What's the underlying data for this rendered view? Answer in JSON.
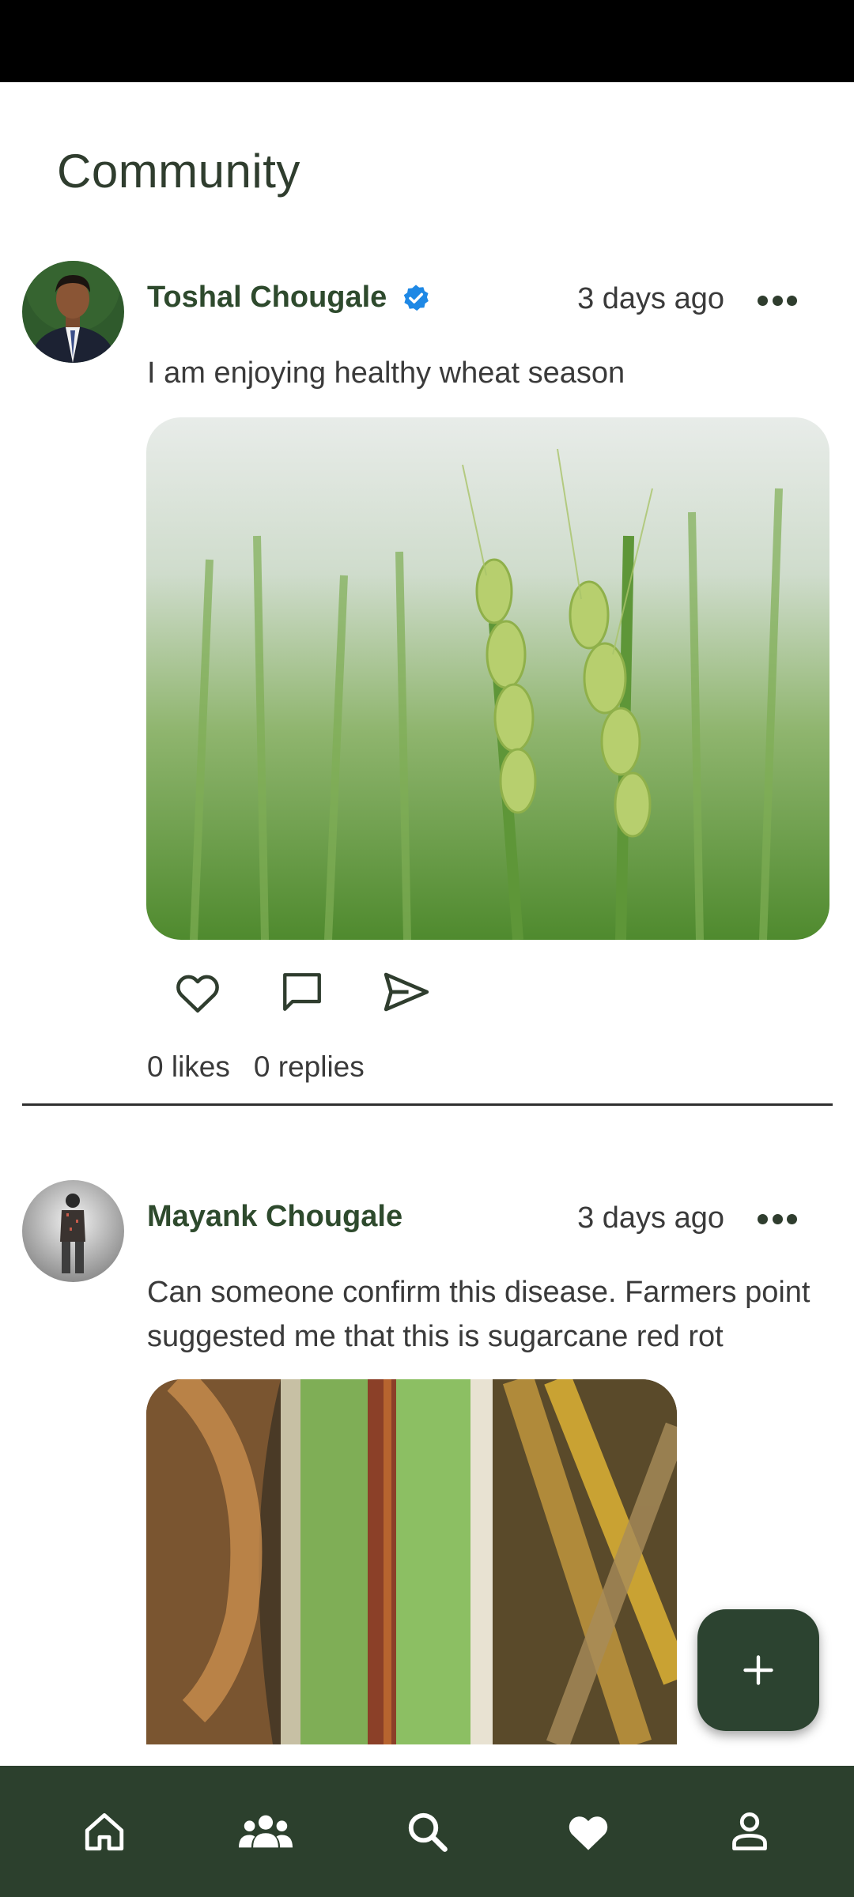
{
  "page": {
    "title": "Community"
  },
  "colors": {
    "primary": "#2c402d",
    "accent_verified": "#1e88e5",
    "text": "#3a3a3a"
  },
  "posts": [
    {
      "author": "Toshal Chougale",
      "verified": true,
      "time": "3 days ago",
      "text": "I am enjoying healthy wheat season",
      "image": "wheat-field-photo",
      "likes_label": "0 likes",
      "replies_label": "0 replies"
    },
    {
      "author": "Mayank Chougale",
      "verified": false,
      "time": "3 days ago",
      "text": "Can someone confirm this disease. Farmers point suggested me that this is sugarcane red rot",
      "image": "sugarcane-leaf-photo"
    }
  ],
  "fab": {
    "icon": "plus-icon"
  },
  "bottom_nav": [
    {
      "icon": "home-icon"
    },
    {
      "icon": "community-icon"
    },
    {
      "icon": "search-icon"
    },
    {
      "icon": "heart-icon"
    },
    {
      "icon": "profile-icon"
    }
  ]
}
